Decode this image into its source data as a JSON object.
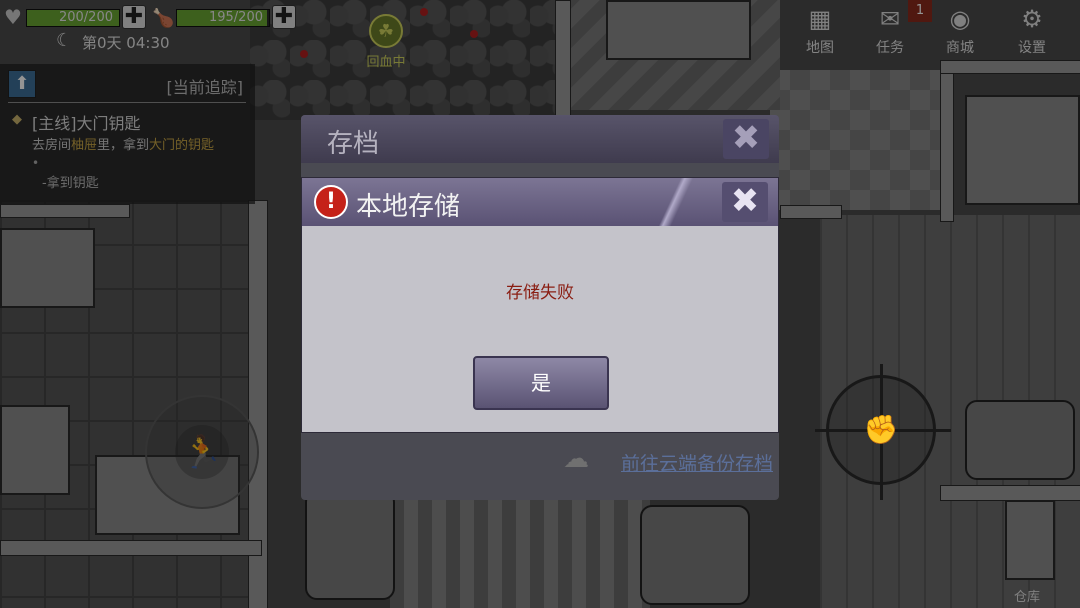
{
  "hud": {
    "health_text": "200/200",
    "health_fraction": 1.0,
    "food_text": "195/200",
    "food_fraction": 0.975,
    "day_time": "第0天 04:30",
    "healing_label": "回血中",
    "plus": "✚"
  },
  "quest": {
    "tracking_label": "[当前追踪]",
    "title": "[主线]大门钥匙",
    "desc_part1": "去房间",
    "desc_highlight1": "柚屉",
    "desc_part2": "里，拿到",
    "desc_highlight2": "大门的钥匙",
    "dot": "•",
    "sub": "-拿到钥匙"
  },
  "menu": {
    "map": "地图",
    "tasks": "任务",
    "tasks_badge": "1",
    "shop": "商城",
    "settings": "设置"
  },
  "warehouse_label": "仓库",
  "back_dialog": {
    "title": "存档",
    "close": "✖",
    "cloud_link": "前往云端备份存档"
  },
  "dialog": {
    "title": "本地存储",
    "close": "✖",
    "warning_mark": "!",
    "message": "存储失败",
    "yes_label": "是"
  },
  "colors": {
    "health": "#6aa533",
    "dialog_header": "#5a5274",
    "error_text": "#8a1d12",
    "warning": "#c52219",
    "link": "#5b6f9a"
  }
}
